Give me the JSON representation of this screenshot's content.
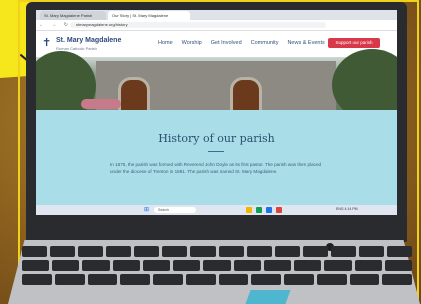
{
  "browser": {
    "tabs": [
      {
        "label": "St. Mary Magdalene Parish"
      },
      {
        "label": "Our Story | St. Mary Magdalene"
      }
    ],
    "url": "stmarymagdalene.org/history"
  },
  "site": {
    "title": "St. Mary Magdalene",
    "subtitle": "Roman Catholic Parish",
    "nav": [
      "Home",
      "Worship",
      "Get Involved",
      "Community",
      "News & Events"
    ],
    "cta": "Support our parish"
  },
  "content": {
    "heading": "History of our parish",
    "body": "In 1875, the parish was formed with Reverend John Doyle as its first pastor. The parish was then placed under the diocese of Trenton in 1881. The parish was named St. Mary Magdalene."
  },
  "taskbar": {
    "search_placeholder": "Search",
    "tray": "ENG 4:14 PM"
  },
  "colors": {
    "brand": "#2a4a7a",
    "accent": "#d8394a",
    "band": "#a9dde8",
    "sticky_note": "#f5e71c"
  }
}
